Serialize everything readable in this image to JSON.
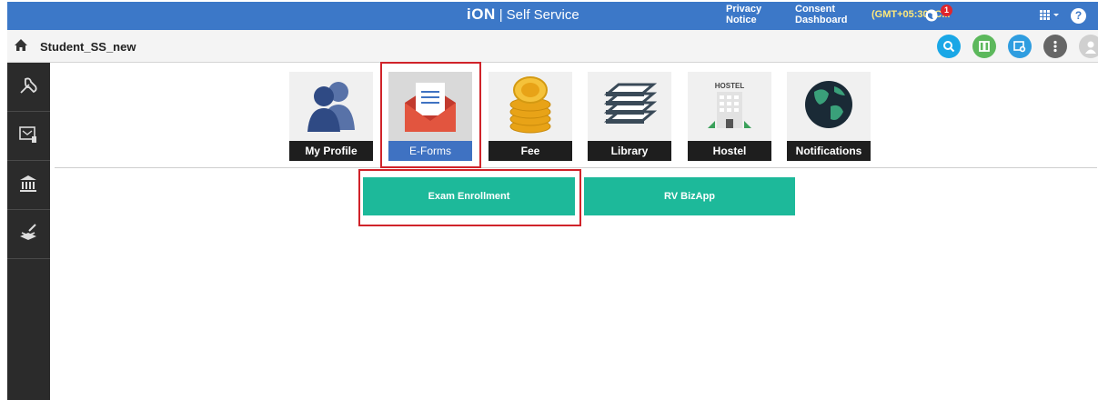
{
  "topbar": {
    "logo": "iON",
    "product": "Self Service",
    "privacy_label": "Privacy Notice",
    "consent_label": "Consent Dashboard",
    "timezone": "(GMT+05:30) C...",
    "notification_count": "1",
    "help_label": "?"
  },
  "breadcrumb": {
    "title": "Student_SS_new"
  },
  "colors": {
    "header_blue": "#3c78c8",
    "action_teal": "#1db99a",
    "highlight_red": "#d0232a",
    "sidebar_dark": "#2b2b2b",
    "search_circle": "#1aa7e6",
    "green_circle": "#5cb85c",
    "blue_circle": "#2f9de0",
    "menu_circle": "#666666"
  },
  "tiles": [
    {
      "label": "My Profile",
      "icon": "profile-icon"
    },
    {
      "label": "E-Forms",
      "icon": "envelope-icon",
      "active": true
    },
    {
      "label": "Fee",
      "icon": "coins-icon"
    },
    {
      "label": "Library",
      "icon": "books-icon"
    },
    {
      "label": "Hostel",
      "icon": "hostel-icon",
      "sign": "HOSTEL"
    },
    {
      "label": "Notifications",
      "icon": "globe-icon"
    }
  ],
  "forms": [
    {
      "label": "Exam Enrollment"
    },
    {
      "label": "RV BizApp"
    }
  ],
  "sidebar": {
    "items": [
      "tools-icon",
      "message-icon",
      "institution-icon",
      "stack-icon"
    ]
  }
}
